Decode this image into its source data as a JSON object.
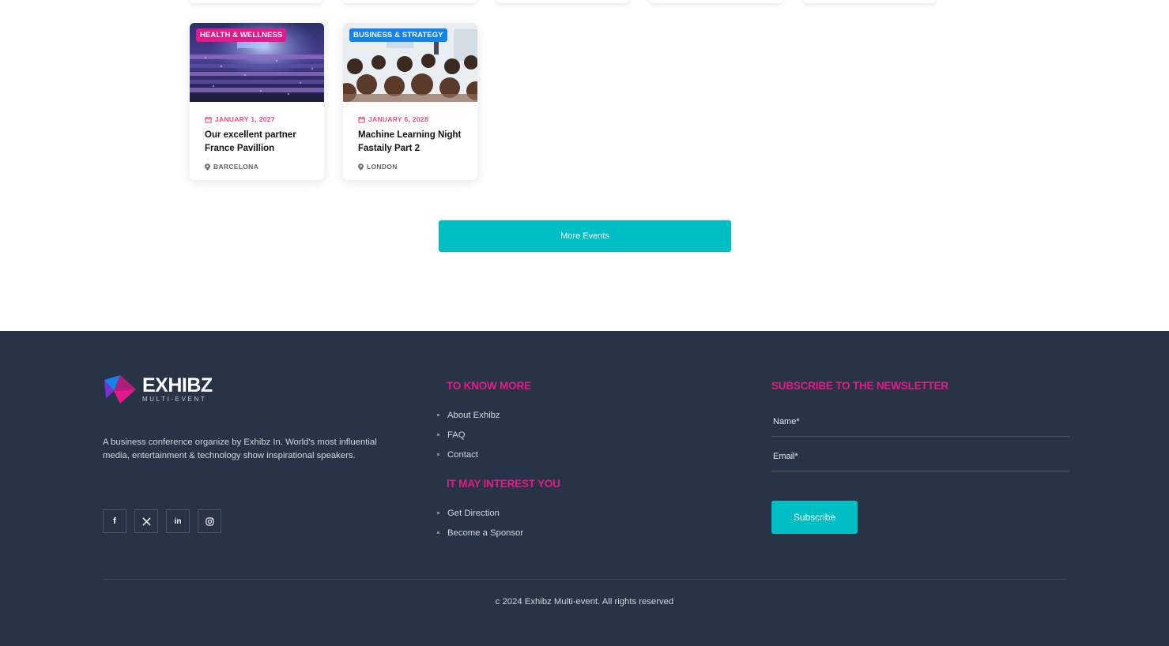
{
  "events": [
    {
      "category": "HEALTH & WELLNESS",
      "date": "JANUARY 1, 2027",
      "title": "Our excellent partner France Pavillion",
      "location": "BARCELONA"
    },
    {
      "category": "BUSINESS & STRATEGY",
      "date": "JANUARY 6, 2028",
      "title": "Machine Learning Night Fastaily Part 2",
      "location": "LONDON"
    }
  ],
  "more_events_label": "More Events",
  "footer": {
    "logo_main": "EXHIBZ",
    "logo_sub": "MULTI-EVENT",
    "about": "A business conference organize by Exhibz In. World's most influential media, entertainment & technology show inspirational speakers.",
    "socials": [
      {
        "icon": "facebook-icon",
        "glyph": "f"
      },
      {
        "icon": "x-twitter-icon",
        "glyph": "𝕏"
      },
      {
        "icon": "linkedin-icon",
        "glyph": "in"
      },
      {
        "icon": "instagram-icon",
        "glyph": "◎"
      }
    ],
    "know_more_heading": "TO KNOW MORE",
    "know_more_links": [
      "About Exhibz",
      "FAQ",
      "Contact"
    ],
    "interest_heading": "IT MAY INTEREST YOU",
    "interest_links": [
      "Get Direction",
      "Become a Sponsor"
    ],
    "newsletter_heading": "SUBSCRIBE TO THE NEWSLETTER",
    "name_placeholder": "Name*",
    "email_placeholder": "Email*",
    "subscribe_label": "Subscribe",
    "copyright": "c 2024 Exhibz Multi-event. All rights reserved"
  },
  "colors": {
    "accent_teal": "#00bfc4",
    "accent_pink": "#e6198c",
    "tag_blue": "#1382ec",
    "footer_bg": "#263445",
    "date_color": "#e8527a"
  }
}
